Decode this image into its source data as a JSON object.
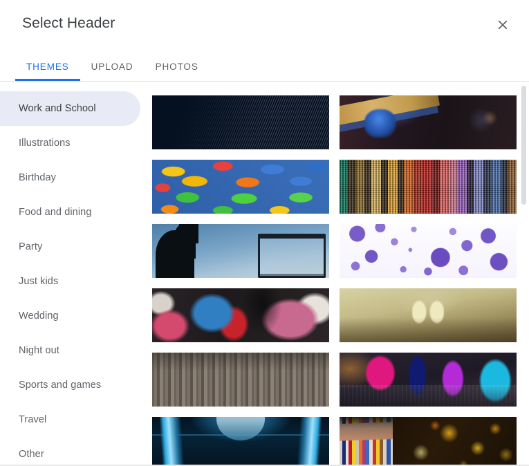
{
  "dialog": {
    "title": "Select Header",
    "close_icon": "close-icon",
    "close_label": "Close"
  },
  "tabs": [
    {
      "label": "THEMES",
      "active": true
    },
    {
      "label": "UPLOAD",
      "active": false
    },
    {
      "label": "PHOTOS",
      "active": false
    }
  ],
  "sidebar": {
    "items": [
      {
        "label": "Work and School",
        "selected": true
      },
      {
        "label": "Illustrations",
        "selected": false
      },
      {
        "label": "Birthday",
        "selected": false
      },
      {
        "label": "Food and dining",
        "selected": false
      },
      {
        "label": "Party",
        "selected": false
      },
      {
        "label": "Just kids",
        "selected": false
      },
      {
        "label": "Wedding",
        "selected": false
      },
      {
        "label": "Night out",
        "selected": false
      },
      {
        "label": "Sports and games",
        "selected": false
      },
      {
        "label": "Travel",
        "selected": false
      },
      {
        "label": "Other",
        "selected": false
      }
    ]
  },
  "gallery": {
    "thumbnails": [
      {
        "name": "blue-data-streaks",
        "art": "art-data-streaks"
      },
      {
        "name": "guitar-concert",
        "art": "art-guitar"
      },
      {
        "name": "colorful-candy",
        "art": "art-candy"
      },
      {
        "name": "colorful-yarn-strips",
        "art": "art-yarn"
      },
      {
        "name": "basketball-silhouette",
        "art": "art-basketball"
      },
      {
        "name": "purple-cells",
        "art": "art-cells"
      },
      {
        "name": "painted-hands",
        "art": "art-hands"
      },
      {
        "name": "book-pages-heart",
        "art": "art-book"
      },
      {
        "name": "paintbrushes",
        "art": "art-brushes"
      },
      {
        "name": "lab-flasks",
        "art": "art-flasks"
      },
      {
        "name": "blue-machinery",
        "art": "art-machine"
      },
      {
        "name": "colored-pencils-bokeh",
        "art": "art-pencils"
      }
    ]
  },
  "colors": {
    "accent": "#1a73e8",
    "selected_item_bg": "#e8eaf6",
    "text_primary": "#3c4043",
    "text_secondary": "#5f6368",
    "divider": "#e0e0e0",
    "scrollbar": "#dadce0"
  }
}
